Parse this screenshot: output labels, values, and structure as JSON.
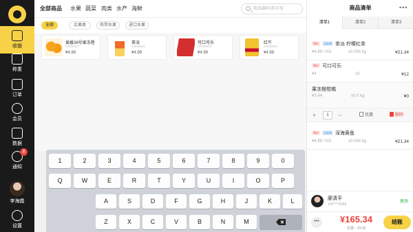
{
  "sidebar": {
    "items": [
      {
        "label": "收银"
      },
      {
        "label": "称重"
      },
      {
        "label": "订单"
      },
      {
        "label": "会员"
      },
      {
        "label": "数据"
      },
      {
        "label": "通知"
      },
      {
        "label": "设置"
      }
    ],
    "notification_count": "8",
    "user_name": "李海霞"
  },
  "categories": [
    "全部商品",
    "水果",
    "蔬菜",
    "肉类",
    "水产",
    "海鲜"
  ],
  "search": {
    "placeholder": "商品编码/首字母"
  },
  "subcategories": [
    "全部",
    "瓜果类",
    "热带水果",
    "进口水果"
  ],
  "products": [
    {
      "name": "爱媛38号果冻橙",
      "code": "04535522",
      "price": "¥4.99"
    },
    {
      "name": "茶派",
      "code": "04535522",
      "price": "¥4.99"
    },
    {
      "name": "可口可乐",
      "code": "04535522",
      "price": "¥4.99"
    },
    {
      "name": "红牛",
      "code": "04535522",
      "price": "¥4.99"
    }
  ],
  "keyboard": {
    "row1": [
      "1",
      "2",
      "3",
      "4",
      "5",
      "6",
      "7",
      "8",
      "9",
      "0"
    ],
    "row2": [
      "Q",
      "W",
      "E",
      "R",
      "T",
      "Y",
      "U",
      "I",
      "O",
      "P"
    ],
    "row3": [
      "A",
      "S",
      "D",
      "F",
      "G",
      "H",
      "J",
      "K",
      "L"
    ],
    "row4": [
      "Z",
      "X",
      "C",
      "V",
      "B",
      "N",
      "M"
    ]
  },
  "panel": {
    "title": "商品清单",
    "tabs": [
      "清单1",
      "清单2",
      "清单3"
    ],
    "items": [
      {
        "tag": "特价",
        "tag2": "无促销",
        "name": "茶派 柠檬红茶",
        "unit_price": "¥4.99 / KG",
        "qty": "x0.054 kg",
        "total": "¥21.34"
      },
      {
        "tag": "特价",
        "name": "可口可乐",
        "unit_price": "¥4",
        "qty": "x3",
        "total": "¥12"
      },
      {
        "name": "果冻橙柑橘",
        "unit_price": "¥3.44",
        "qty": "x0.0 kg",
        "total": "¥0"
      },
      {
        "tag": "特价",
        "tag2": "无促销",
        "name": "深海黄鱼",
        "unit_price": "¥4.99 / KG",
        "qty": "x0.054 kg",
        "total": "¥21.34"
      }
    ],
    "edit": {
      "qty": "1",
      "discount_label": "优惠",
      "delete_label": "删除"
    },
    "member": {
      "name": "廖清平",
      "phone": "159****6958",
      "change_label": "更改"
    },
    "footer": {
      "total": "¥165.34",
      "discount": "优惠：¥3.00",
      "checkout_label": "结账",
      "more_label": "•••"
    }
  }
}
